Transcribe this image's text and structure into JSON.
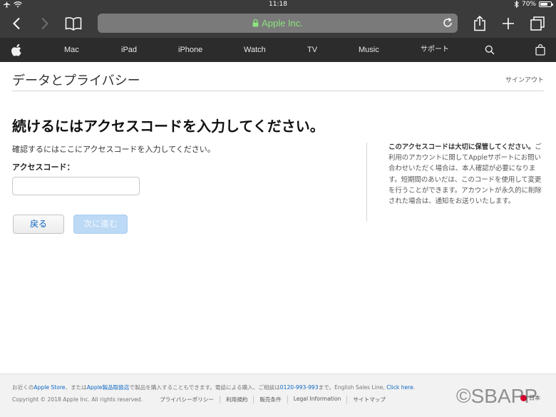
{
  "status_bar": {
    "time": "11:18",
    "battery_percent": "70%",
    "battery_level": 0.7
  },
  "browser": {
    "host": "Apple Inc."
  },
  "nav": {
    "items": [
      "Mac",
      "iPad",
      "iPhone",
      "Watch",
      "TV",
      "Music",
      "サポート"
    ]
  },
  "page": {
    "title": "データとプライバシー",
    "sign_out": "サインアウト"
  },
  "main": {
    "heading": "続けるにはアクセスコードを入力してください。",
    "instruction": "確認するにはここにアクセスコードを入力してください。",
    "field_label": "アクセスコード：",
    "field_value": "",
    "back_label": "戻る",
    "next_label": "次に進む"
  },
  "side_note": {
    "bold": "このアクセスコードは大切に保管してください。",
    "body": "ご利用のアカウントに関してAppleサポートにお問い合わせいただく場合は、本人確認が必要になります。短期間のあいだは、このコードを使用して変更を行うことができます。アカウントが永久的に削除された場合は、通知をお送りいたします。"
  },
  "footer": {
    "p1": "お近くの",
    "apple_store": "Apple Store",
    "p2": "、または",
    "reseller": "Apple製品取扱店",
    "p3": "で製品を購入することもできます。電話による購入、ご相談は",
    "phone": "0120-993-993",
    "p4": "まで。English Sales Line, ",
    "click_here": "Click here",
    "p5": ".",
    "copyright": "Copyright © 2018 Apple Inc. All rights reserved.",
    "links": [
      "プライバシーポリシー",
      "利用規約",
      "販売条件",
      "Legal Information",
      "サイトマップ"
    ],
    "locale": "日本"
  },
  "watermark": "©SBAPP",
  "colors": {
    "link": "#0a66c2",
    "secure_host": "#8ce37e",
    "nav_bg": "#2c2c2c"
  }
}
